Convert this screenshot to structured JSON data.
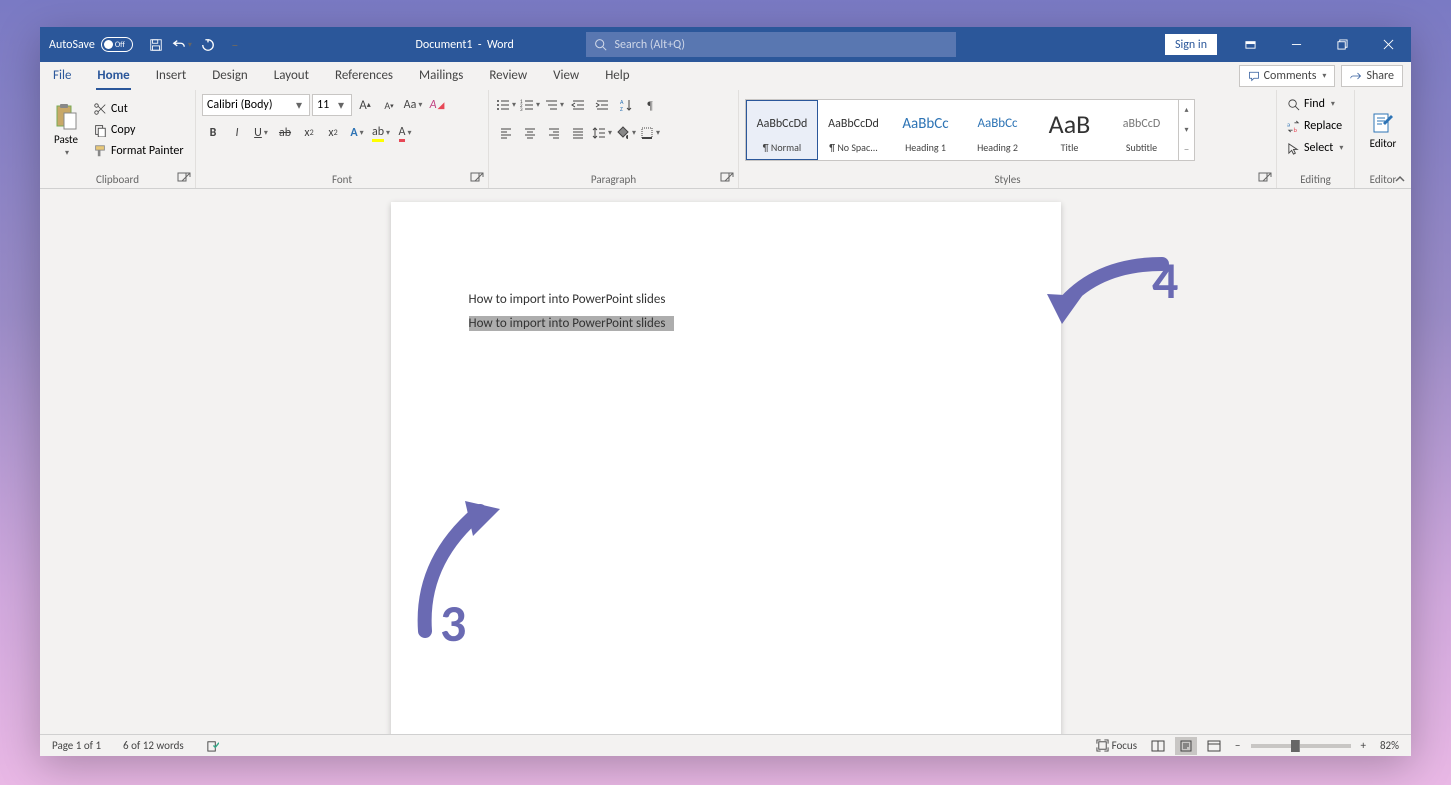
{
  "titlebar": {
    "autosave_label": "AutoSave",
    "autosave_state": "Off",
    "doc_name": "Document1",
    "app_name": "Word",
    "search_placeholder": "Search (Alt+Q)",
    "signin": "Sign in"
  },
  "tabs": {
    "file": "File",
    "home": "Home",
    "insert": "Insert",
    "design": "Design",
    "layout": "Layout",
    "references": "References",
    "mailings": "Mailings",
    "review": "Review",
    "view": "View",
    "help": "Help",
    "comments": "Comments",
    "share": "Share"
  },
  "clipboard": {
    "label": "Clipboard",
    "paste": "Paste",
    "cut": "Cut",
    "copy": "Copy",
    "format_painter": "Format Painter"
  },
  "font": {
    "label": "Font",
    "family": "Calibri (Body)",
    "size": "11"
  },
  "paragraph": {
    "label": "Paragraph"
  },
  "styles": {
    "label": "Styles",
    "items": [
      {
        "preview": "AaBbCcDd",
        "name": "¶ Normal",
        "css": "font-size:12px;"
      },
      {
        "preview": "AaBbCcDd",
        "name": "¶ No Spac...",
        "css": "font-size:12px;"
      },
      {
        "preview": "AaBbCc",
        "name": "Heading 1",
        "css": "font-size:15px;color:#2e74b5;"
      },
      {
        "preview": "AaBbCc",
        "name": "Heading 2",
        "css": "font-size:13px;color:#2e74b5;"
      },
      {
        "preview": "AaB",
        "name": "Title",
        "css": "font-size:26px;"
      },
      {
        "preview": "aBbCcD",
        "name": "Subtitle",
        "css": "font-size:12px;color:#777;"
      }
    ]
  },
  "editing": {
    "label": "Editing",
    "find": "Find",
    "replace": "Replace",
    "select": "Select"
  },
  "editor": {
    "label": "Editor",
    "button": "Editor"
  },
  "document": {
    "line1": "How to import into PowerPoint slides",
    "line2": "How to import into PowerPoint slides"
  },
  "annotations": {
    "n3": "3",
    "n4": "4"
  },
  "statusbar": {
    "page": "Page 1 of 1",
    "words": "6 of 12 words",
    "focus": "Focus",
    "zoom": "82%"
  }
}
